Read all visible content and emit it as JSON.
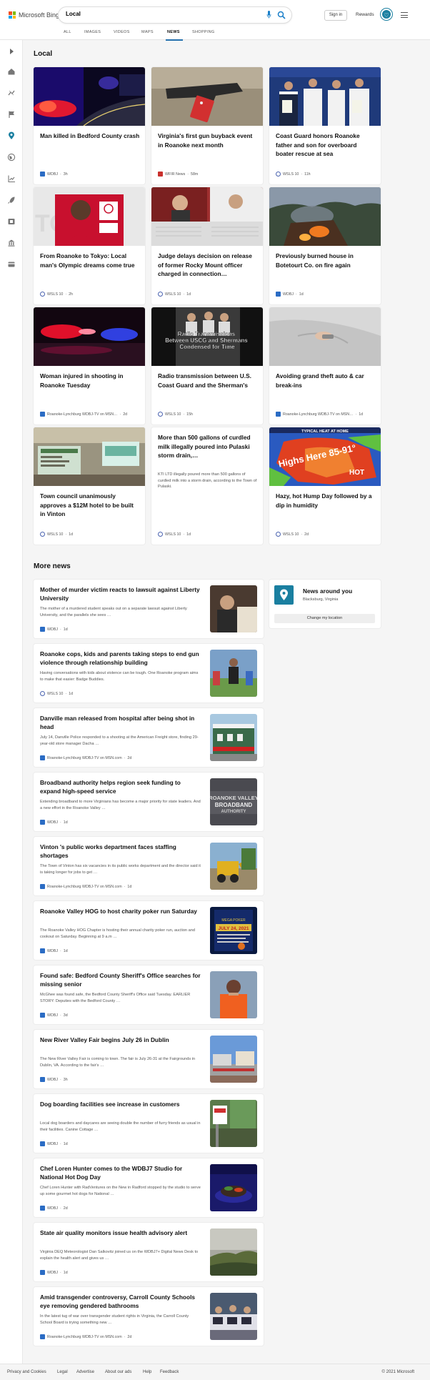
{
  "brand": {
    "name": "Microsoft Bing"
  },
  "search": {
    "query": "Local"
  },
  "header": {
    "signin": "Sign in",
    "rewards": "Rewards"
  },
  "tabs": [
    {
      "label": "ALL"
    },
    {
      "label": "IMAGES"
    },
    {
      "label": "VIDEOS"
    },
    {
      "label": "MAPS"
    },
    {
      "label": "NEWS"
    },
    {
      "label": "SHOPPING"
    }
  ],
  "active_tab": "NEWS",
  "local": {
    "title": "Local",
    "cards": [
      {
        "title": "Man killed in Bedford County crash",
        "source": "WDBJ",
        "age": "3h",
        "src": "wdbj"
      },
      {
        "title": "Virginia's first gun buyback event in Roanoke next month",
        "source": "WFIR News",
        "age": "58m",
        "src": "wfir"
      },
      {
        "title": "Coast Guard honors Roanoke father and son for overboard boater rescue at sea",
        "source": "WSLS 10",
        "age": "11h",
        "src": "wsls"
      },
      {
        "title": "From Roanoke to Tokyo: Local man's Olympic dreams come true",
        "source": "WSLS 10",
        "age": "2h",
        "src": "wsls"
      },
      {
        "title": "Judge delays decision on release of former Rocky Mount officer charged in connection…",
        "source": "WSLS 10",
        "age": "1d",
        "src": "wsls"
      },
      {
        "title": "Previously burned house in Botetourt Co. on fire again",
        "source": "WDBJ",
        "age": "1d",
        "src": "wdbj"
      },
      {
        "title": "Woman injured in shooting in Roanoke Tuesday",
        "source": "Roanoke-Lynchburg WDBJ-TV on MSN…",
        "age": "2d",
        "src": "wdbj"
      },
      {
        "title": "Radio transmission between U.S. Coast Guard and the Sherman's",
        "source": "WSLS 10",
        "age": "15h",
        "src": "wsls",
        "img_caption": "Radio Transmissions Between USCG and Shermans Condensed for Time"
      },
      {
        "title": "Avoiding grand theft auto & car break-ins",
        "source": "Roanoke-Lynchburg WDBJ-TV on MSN…",
        "age": "1d",
        "src": "wdbj"
      },
      {
        "title": "Town council unanimously approves a $12M hotel to be built in Vinton",
        "source": "WSLS 10",
        "age": "1d",
        "src": "wsls"
      },
      {
        "title": "More than 500 gallons of curdled milk illegally poured into Pulaski storm drain,…",
        "snippet": "KTI LTD illegally poured more than 500 gallons of curdled milk into a storm drain, according to the Town of Pulaski.",
        "source": "WSLS 10",
        "age": "1d",
        "src": "wsls"
      },
      {
        "title": "Hazy, hot Hump Day followed by a dip in humidity",
        "source": "WSLS 10",
        "age": "2d",
        "src": "wsls",
        "img_text": "Highs Here 85-91°",
        "img_banner": "TYPICAL HEAT AT HOME",
        "img_tag": "HOT"
      }
    ]
  },
  "more_news": {
    "title": "More news",
    "items": [
      {
        "title": "Mother of murder victim reacts to lawsuit against Liberty University",
        "snippet": "The mother of a murdered student speaks out on a separate lawsuit against Liberty University, and the parallels she sees …",
        "source": "WDBJ",
        "age": "1d",
        "src": "wdbj"
      },
      {
        "title": "Roanoke cops, kids and parents taking steps to end gun violence through relationship building",
        "snippet": "Having conversations with kids about violence can be tough. One Roanoke program aims to make that easier: Badge Buddies.",
        "source": "WSLS 10",
        "age": "1d",
        "src": "wsls"
      },
      {
        "title": "Danville man released from hospital after being shot in head",
        "snippet": "July 14, Danville Police responded to a shooting at the American Freight store, finding 29-year-old store manager Dacha …",
        "source": "Roanoke-Lynchburg WDBJ-TV on MSN.com",
        "age": "2d",
        "src": "wdbj"
      },
      {
        "title": "Broadband authority helps region seek funding to expand high-speed service",
        "snippet": "Extending broadband to more Virginians has become a major priority for state leaders. And a new effort in the Roanoke Valley …",
        "source": "WDBJ",
        "age": "1d",
        "src": "wdbj",
        "img_text": "ROANOKE VALLEY BROADBAND AUTHORITY"
      },
      {
        "title": "Vinton 's public works department faces staffing shortages",
        "snippet": "The Town of Vinton has six vacancies in its public works department and the director said it is taking longer for jobs to get …",
        "source": "Roanoke-Lynchburg WDBJ-TV on MSN.com",
        "age": "1d",
        "src": "wdbj"
      },
      {
        "title": "Roanoke Valley HOG to host charity poker run Saturday",
        "snippet": "The Roanoke Valley HOG Chapter is hosting their annual charity poker run, auction and cookout on Saturday. Beginning at 9 a.m …",
        "source": "WDBJ",
        "age": "1d",
        "src": "wdbj",
        "img_text": "JULY 24, 2021"
      },
      {
        "title": "Found safe: Bedford County Sheriff's Office searches for missing senior",
        "snippet": "McGhee was found safe, the Bedford County Sheriff's Office said Tuesday. EARLIER STORY: Deputies with the Bedford County …",
        "source": "WDBJ",
        "age": "3d",
        "src": "wdbj"
      },
      {
        "title": "New River Valley Fair begins July 26 in Dublin",
        "snippet": "The New River Valley Fair is coming to town. The fair is July 26-31 at the Fairgrounds in Dublin, VA. According to the fair's …",
        "source": "WDBJ",
        "age": "3h",
        "src": "wdbj"
      },
      {
        "title": "Dog boarding facilities see increase in customers",
        "snippet": "Local dog boarders and daycares are seeing double the number of furry friends as usual in their facilities. Canine Cottage …",
        "source": "WDBJ",
        "age": "1d",
        "src": "wdbj"
      },
      {
        "title": "Chef Loren Hunter comes to the WDBJ7 Studio for National Hot Dog Day",
        "snippet": "Chef Loren Hunter with RadVentures on the New in Radford stopped by the studio to serve up some gourmet hot dogs for National …",
        "source": "WDBJ",
        "age": "2d",
        "src": "wdbj"
      },
      {
        "title": "State air quality monitors issue health advisory alert",
        "snippet": "Virginia DEQ Meteorologist Dan Salkovitz joined us on the WDBJ7+ Digital News Desk to explain the health alert and gives us …",
        "source": "WDBJ",
        "age": "1d",
        "src": "wdbj"
      },
      {
        "title": "Amid transgender controversy, Carroll County Schools eye removing gendered bathrooms",
        "snippet": "In the latest tug of war over transgender student rights in Virginia, the Carroll County School Board is trying something new …",
        "source": "Roanoke-Lynchburg WDBJ-TV on MSN.com",
        "age": "2d",
        "src": "wdbj"
      }
    ]
  },
  "news_around": {
    "title": "News around you",
    "location": "Blacksburg, Virginia",
    "button": "Change my location"
  },
  "footer": {
    "links": [
      "Privacy and Cookies",
      "Legal",
      "Advertise",
      "About our ads",
      "Help",
      "Feedback"
    ],
    "copyright": "© 2021 Microsoft"
  }
}
